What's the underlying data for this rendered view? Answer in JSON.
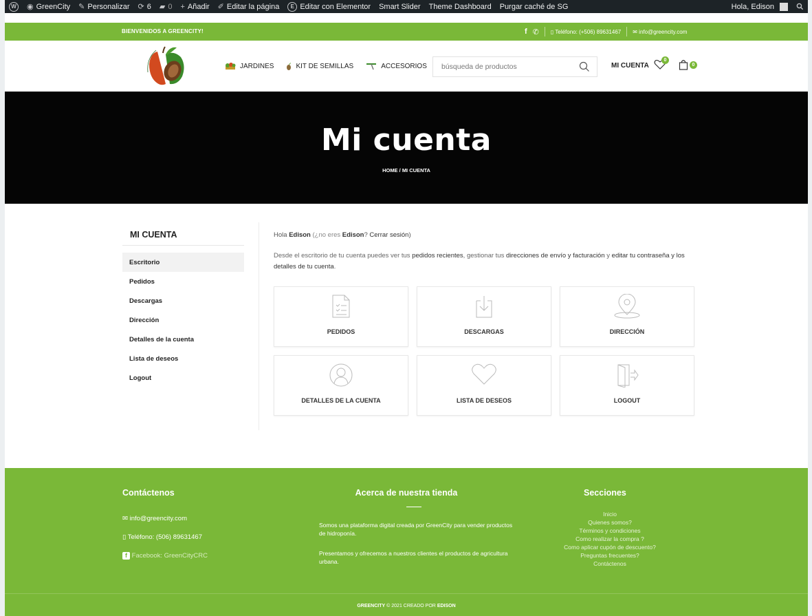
{
  "admin_bar": {
    "site_name": "GreenCity",
    "customize": "Personalizar",
    "updates_count": "6",
    "comments_count": "0",
    "add_new": "Añadir",
    "edit_page": "Editar la página",
    "edit_elementor": "Editar con Elementor",
    "smart_slider": "Smart Slider",
    "theme_dashboard": "Theme Dashboard",
    "purge_cache": "Purgar caché de SG",
    "greeting": "Hola, Edison"
  },
  "topbar": {
    "welcome": "BIENVENIDOS A GREENCITY!",
    "phone": "Teléfono: (+506) 89631467",
    "email": "info@greencity.com"
  },
  "header": {
    "nav": [
      {
        "label": "JARDINES"
      },
      {
        "label": "KIT DE SEMILLAS"
      },
      {
        "label": "ACCESORIOS"
      }
    ],
    "search_placeholder": "búsqueda de productos",
    "account_label": "MI CUENTA",
    "wishlist_count": "0",
    "cart_count": "0",
    "colors": {
      "accent": "#7ab838",
      "dark": "#050505"
    }
  },
  "hero": {
    "title": "Mi cuenta",
    "breadcrumb": "HOME / MI CUENTA"
  },
  "account": {
    "sidebar_title": "MI CUENTA",
    "menu": [
      {
        "label": "Escritorio"
      },
      {
        "label": "Pedidos"
      },
      {
        "label": "Descargas"
      },
      {
        "label": "Dirección"
      },
      {
        "label": "Detalles de la cuenta"
      },
      {
        "label": "Lista de deseos"
      },
      {
        "label": "Logout"
      }
    ],
    "hello_prefix": "Hola",
    "user_name": "Edison",
    "not_you_prefix": "(¿no eres",
    "not_you_name": "Edison",
    "logout_link": "Cerrar sesión",
    "closing_paren": ")",
    "desc_1": "Desde el escritorio de tu cuenta puedes ver tus",
    "desc_link_1": "pedidos recientes",
    "desc_2": ", gestionar tus",
    "desc_link_2": "direcciones de envío y facturación",
    "desc_3": "y",
    "desc_link_3": "editar tu contraseña y los detalles de tu cuenta",
    "desc_4": ".",
    "tiles": [
      {
        "label": "PEDIDOS",
        "icon": "orders-icon"
      },
      {
        "label": "DESCARGAS",
        "icon": "download-icon"
      },
      {
        "label": "DIRECCIÓN",
        "icon": "location-icon"
      },
      {
        "label": "DETALLES DE LA CUENTA",
        "icon": "user-icon"
      },
      {
        "label": "LISTA DE DESEOS",
        "icon": "heart-icon"
      },
      {
        "label": "LOGOUT",
        "icon": "logout-icon"
      }
    ]
  },
  "footer": {
    "contact_title": "Contáctenos",
    "contact_email": "info@greencity.com",
    "contact_phone": "Teléfono: (506) 89631467",
    "contact_facebook": "Facebook: GreenCityCRC",
    "about_title": "Acerca de nuestra tienda",
    "about_p1": "Somos una plataforma digital creada por GreenCity para vender productos de hidroponía.",
    "about_p2": "Presentamos y ofrecemos a nuestros clientes el productos de agricultura urbana.",
    "sections_title": "Secciones",
    "sections": [
      {
        "label": "Inicio"
      },
      {
        "label": "Quienes somos?"
      },
      {
        "label": "Términos y condiciones"
      },
      {
        "label": "Como realizar la compra ?"
      },
      {
        "label": "Como aplicar cupón de descuento?"
      },
      {
        "label": "Preguntas frecuentes?"
      },
      {
        "label": "Contáctenos"
      }
    ],
    "copy_brand": "GREENCITY",
    "copy_rest": "2021 CREADO POR",
    "copy_author": "EDISON"
  }
}
